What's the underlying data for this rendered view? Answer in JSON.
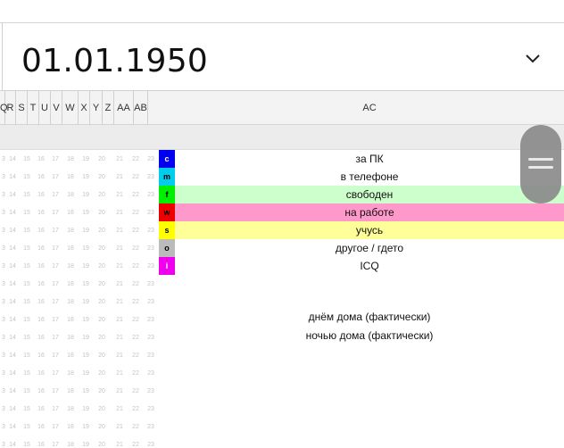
{
  "date_picker": {
    "value": "01.01.1950",
    "chevron_icon": "chevron-down-icon"
  },
  "column_headers": {
    "letters": [
      "Q",
      "R",
      "S",
      "T",
      "U",
      "V",
      "W",
      "X",
      "Y",
      "Z",
      "AA",
      "AB"
    ],
    "ac_label": "AC"
  },
  "hour_numbers": [
    "3",
    "14",
    "15",
    "16",
    "17",
    "18",
    "19",
    "20",
    "21",
    "22",
    "23"
  ],
  "legend": [
    {
      "key": "c",
      "label": "за ПК",
      "key_color": "#0000ee",
      "key_text_color": "#ffffff",
      "row_color": "#ffffff"
    },
    {
      "key": "m",
      "label": "в телефоне",
      "key_color": "#00ccee",
      "key_text_color": "#000000",
      "row_color": "#ffffff"
    },
    {
      "key": "f",
      "label": "свободен",
      "key_color": "#00ee00",
      "key_text_color": "#000000",
      "row_color": "#ccffcc"
    },
    {
      "key": "w",
      "label": "на работе",
      "key_color": "#ee0000",
      "key_text_color": "#000000",
      "row_color": "#ff99cc"
    },
    {
      "key": "s",
      "label": "учусь",
      "key_color": "#ffff00",
      "key_text_color": "#000000",
      "row_color": "#ffff99"
    },
    {
      "key": "o",
      "label": "другое / гдето",
      "key_color": "#bbbbbb",
      "key_text_color": "#000000",
      "row_color": "#ffffff"
    },
    {
      "key": "i",
      "label": "ICQ",
      "key_color": "#ee00ee",
      "key_text_color": "#ffffff",
      "row_color": "#ffffff"
    }
  ],
  "info_lines": {
    "day_home": "днём дома (фактически)",
    "night_home": "ночью дома (фактически)"
  }
}
